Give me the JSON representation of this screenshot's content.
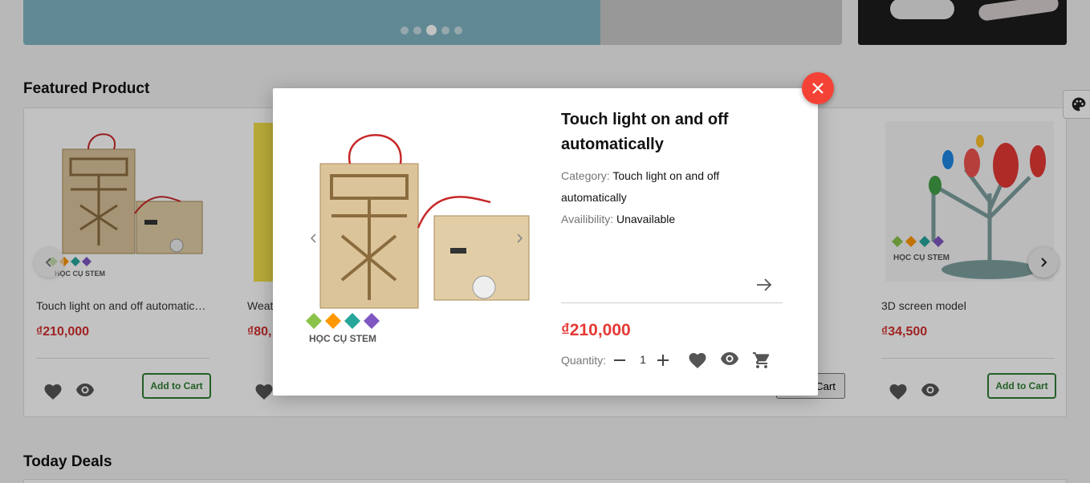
{
  "featured": {
    "title": "Featured Product",
    "products": [
      {
        "name": "Touch light on and off automatic…",
        "price": "₫210,000",
        "add_label": "Add to Cart"
      },
      {
        "name": "Weat",
        "price": "₫80,"
      },
      {
        "name": "3D screen model",
        "price": "₫34,500",
        "add_label": "Add to Cart"
      }
    ],
    "partial_buttons": {
      "card5_label": "Cart"
    }
  },
  "today": {
    "title": "Today Deals"
  },
  "brand": {
    "logo_text": "HỌC CỤ STEM"
  },
  "modal": {
    "title": "Touch light on and off automatically",
    "category_label": "Category:",
    "category_value": "Touch light on and off automatically",
    "availability_label": "Availibility:",
    "availability_value": "Unavailable",
    "price": "₫210,000",
    "quantity_label": "Quantity:",
    "quantity": "1"
  },
  "colors": {
    "accent_red": "#e53935",
    "close_red": "#f44336",
    "button_green": "#2e7d32"
  }
}
